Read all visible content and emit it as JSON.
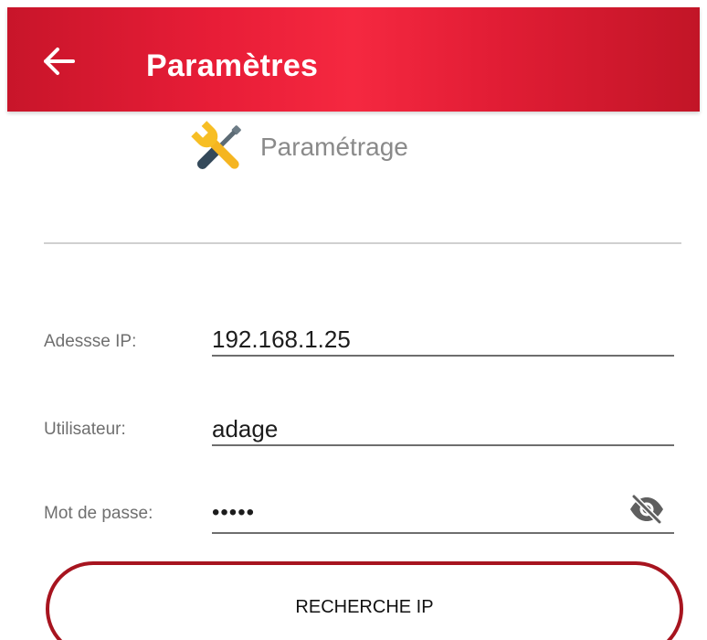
{
  "appbar": {
    "title": "Paramètres",
    "back_icon": "arrow-left-icon"
  },
  "section": {
    "icon": "tools-icon",
    "title": "Paramétrage"
  },
  "form": {
    "ip": {
      "label": "Adessse IP:",
      "value": "192.168.1.25"
    },
    "user": {
      "label": "Utilisateur:",
      "value": "adage"
    },
    "password": {
      "label": "Mot de passe:",
      "value": "•••••",
      "toggle_icon": "eye-off-icon"
    }
  },
  "actions": {
    "search_ip_label": "RECHERCHE IP"
  },
  "colors": {
    "appbar": "#e81d37",
    "button_border": "#a7141f",
    "label_gray": "#6f6f6f"
  }
}
